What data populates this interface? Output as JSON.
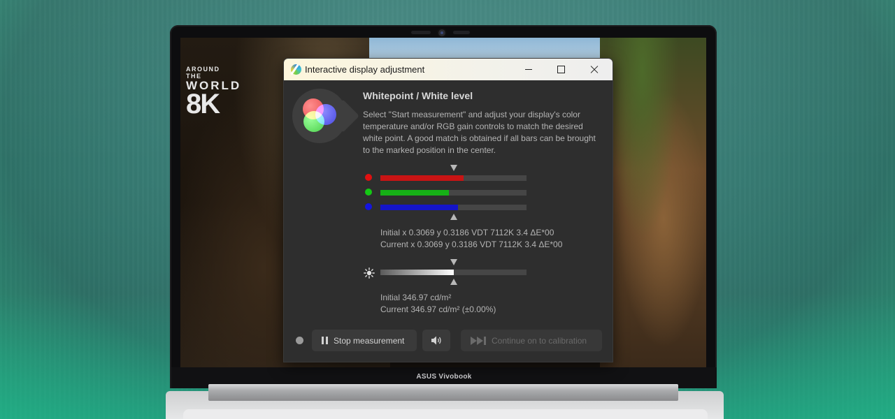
{
  "laptop": {
    "brand_label": "ASUS Vivobook"
  },
  "wallpaper": {
    "logo_line1": "AROUND THE",
    "logo_line2": "WORLD",
    "logo_line3": "8K"
  },
  "dialog": {
    "title": "Interactive display adjustment",
    "heading": "Whitepoint / White level",
    "description": "Select \"Start measurement\" and adjust your display's color temperature and/or RGB gain controls to match the desired white point. A good match is obtained if all bars can be brought to the marked position in the center.",
    "channels": [
      {
        "name": "red",
        "color": "#e01010",
        "bar_color": "#c81414",
        "level": 0.57
      },
      {
        "name": "green",
        "color": "#14c814",
        "bar_color": "#16b016",
        "level": 0.47
      },
      {
        "name": "blue",
        "color": "#1414e0",
        "bar_color": "#1414c8",
        "level": 0.53
      }
    ],
    "whitepoint_initial": "Initial x 0.3069 y 0.3186 VDT 7112K 3.4 ΔE*00",
    "whitepoint_current": "Current x 0.3069 y 0.3186 VDT 7112K 3.4 ΔE*00",
    "luminance_level": 0.5,
    "luminance_initial": "Initial 346.97 cd/m²",
    "luminance_current": "Current 346.97 cd/m² (±0.00%)",
    "buttons": {
      "stop": "Stop measurement",
      "continue": "Continue on to calibration"
    },
    "icons": {
      "app": "displaycal-icon",
      "sound": "speaker-icon",
      "brightness": "sun-icon"
    }
  }
}
